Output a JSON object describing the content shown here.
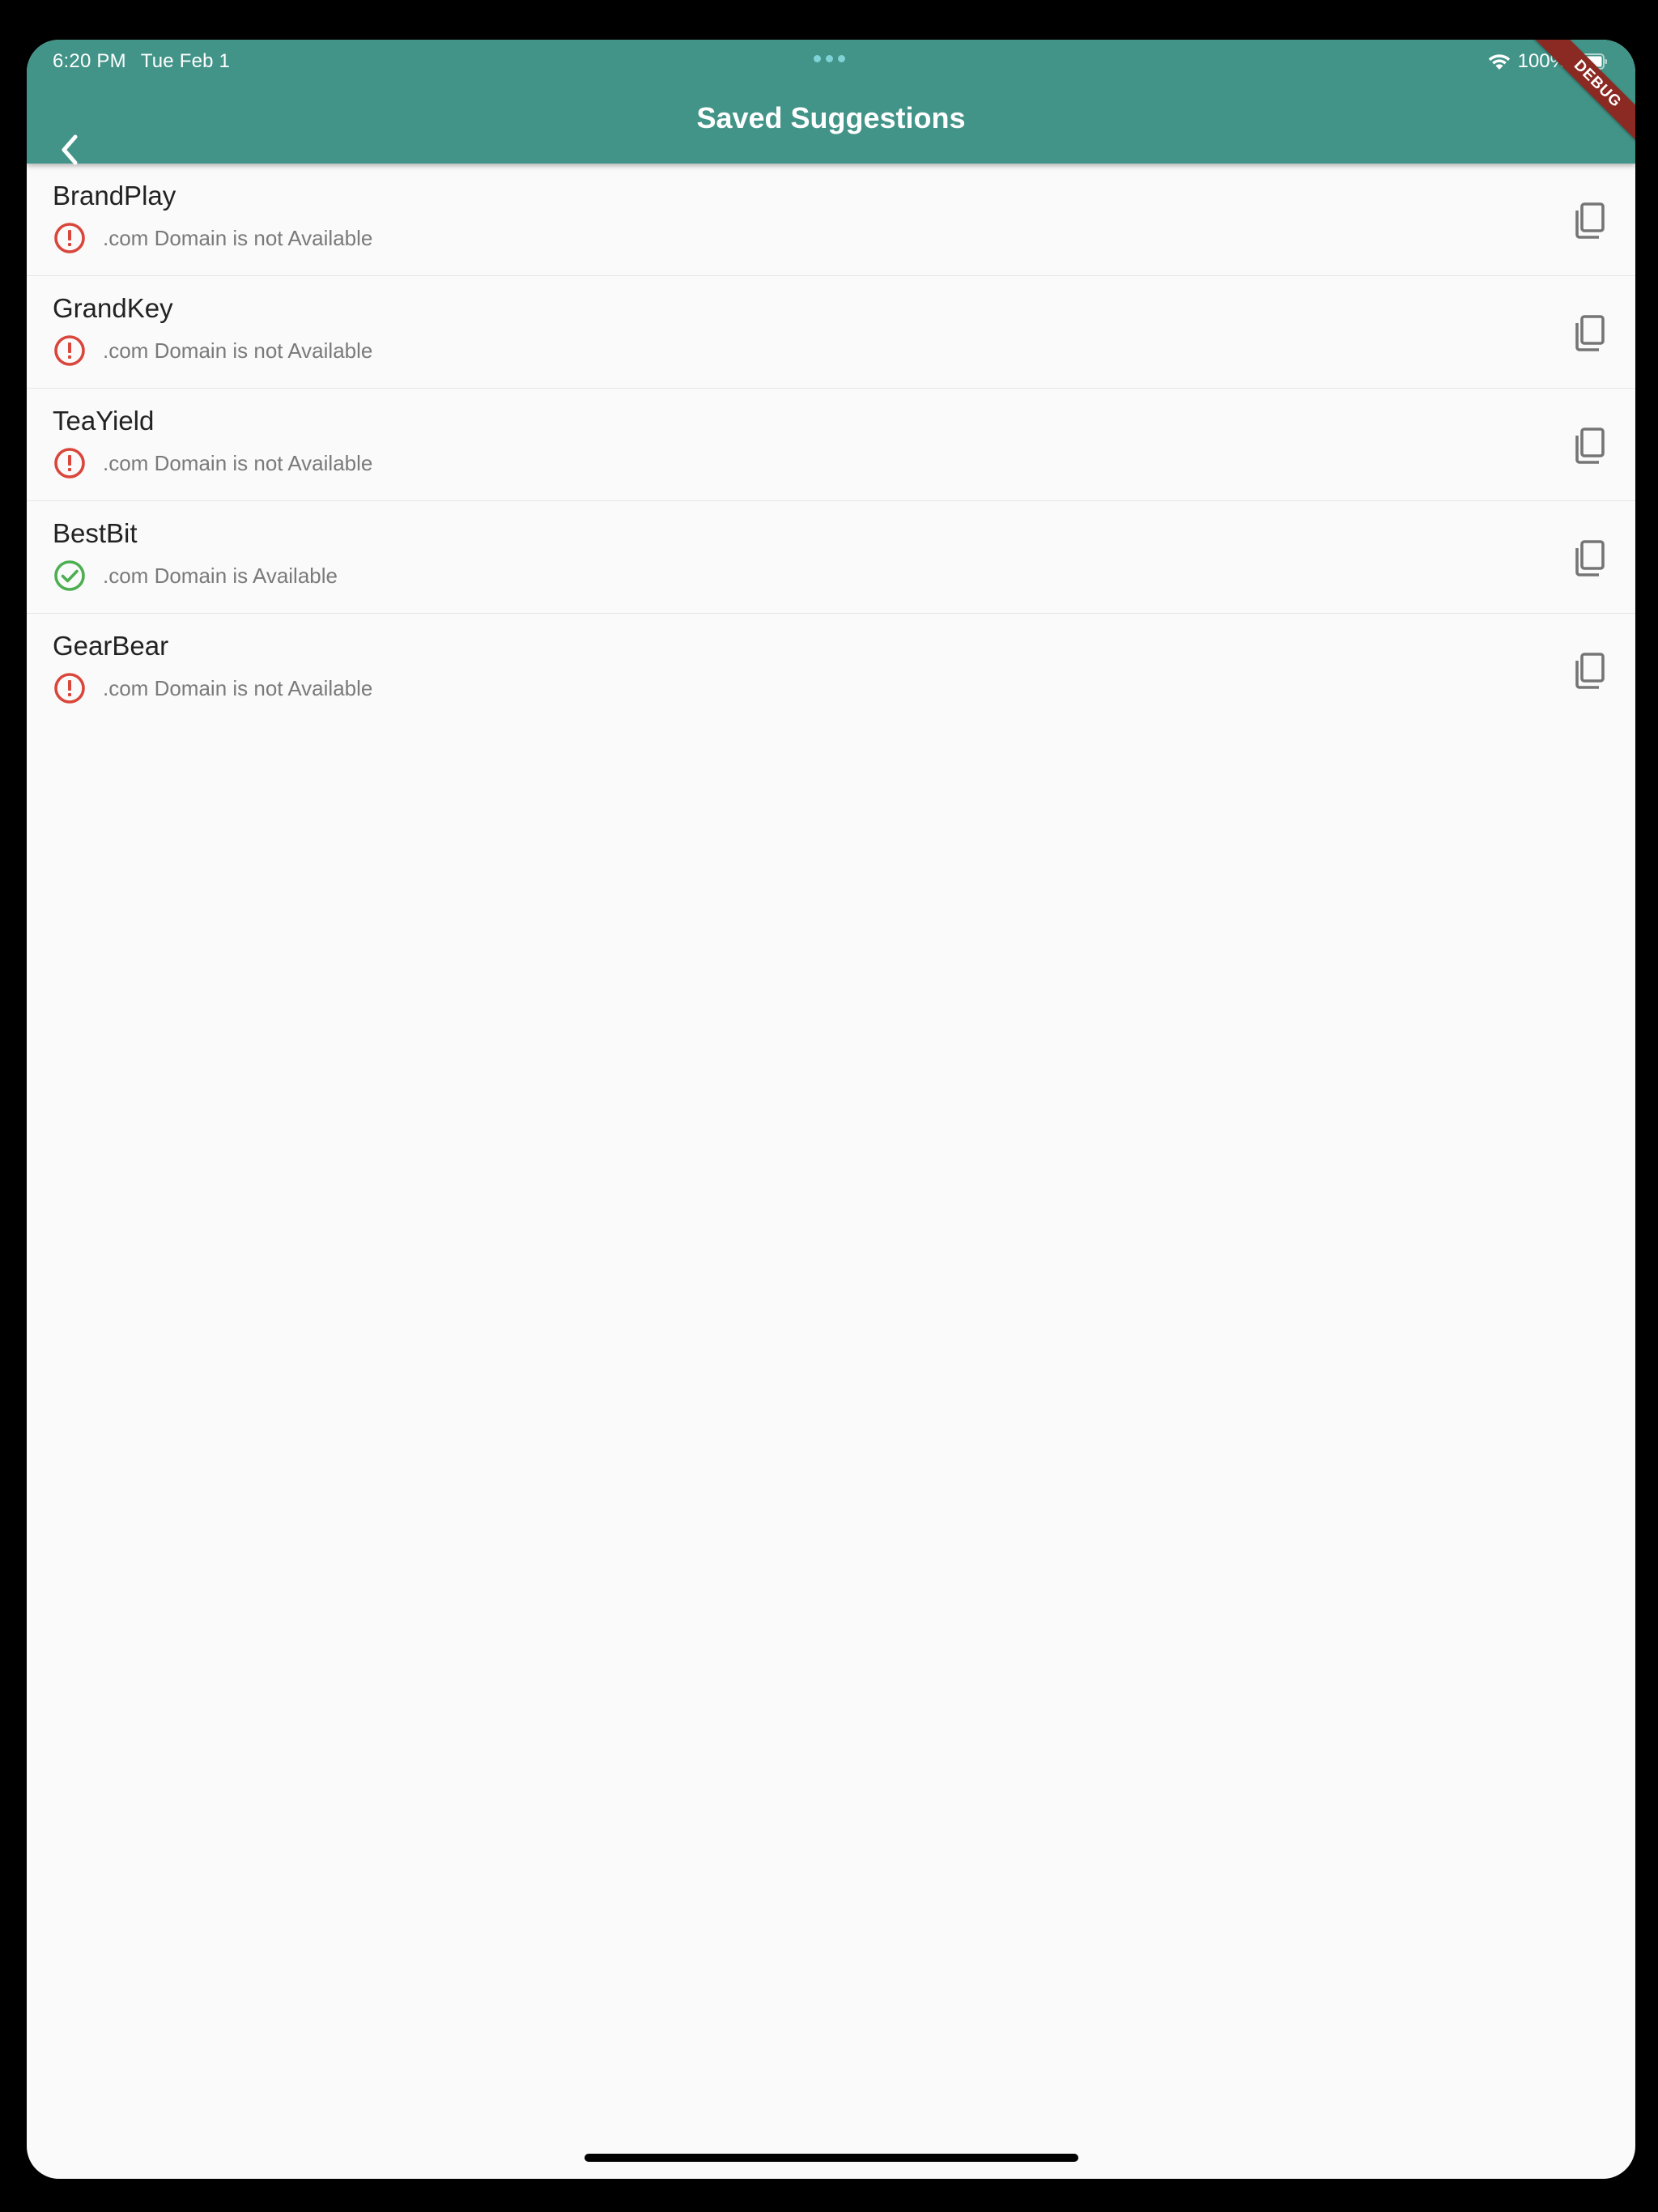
{
  "status_bar": {
    "time": "6:20 PM",
    "date": "Tue Feb 1",
    "battery": "100%"
  },
  "app_bar": {
    "title": "Saved Suggestions",
    "background_color": "#429488",
    "back_icon": "chevron-left-icon"
  },
  "debug_banner": "DEBUG",
  "suggestions": [
    {
      "name": "BrandPlay",
      "status": ".com Domain is not Available",
      "available": false
    },
    {
      "name": "GrandKey",
      "status": ".com Domain is not Available",
      "available": false
    },
    {
      "name": "TeaYield",
      "status": ".com Domain is not Available",
      "available": false
    },
    {
      "name": "BestBit",
      "status": ".com Domain is Available",
      "available": true
    },
    {
      "name": "GearBear",
      "status": ".com Domain is not Available",
      "available": false
    }
  ],
  "colors": {
    "unavailable": "#d9463b",
    "available": "#4caf50",
    "copy_icon": "#757575"
  },
  "icons": {
    "unavailable": "error-outline-icon",
    "available": "check-circle-outline-icon",
    "copy": "copy-icon"
  }
}
